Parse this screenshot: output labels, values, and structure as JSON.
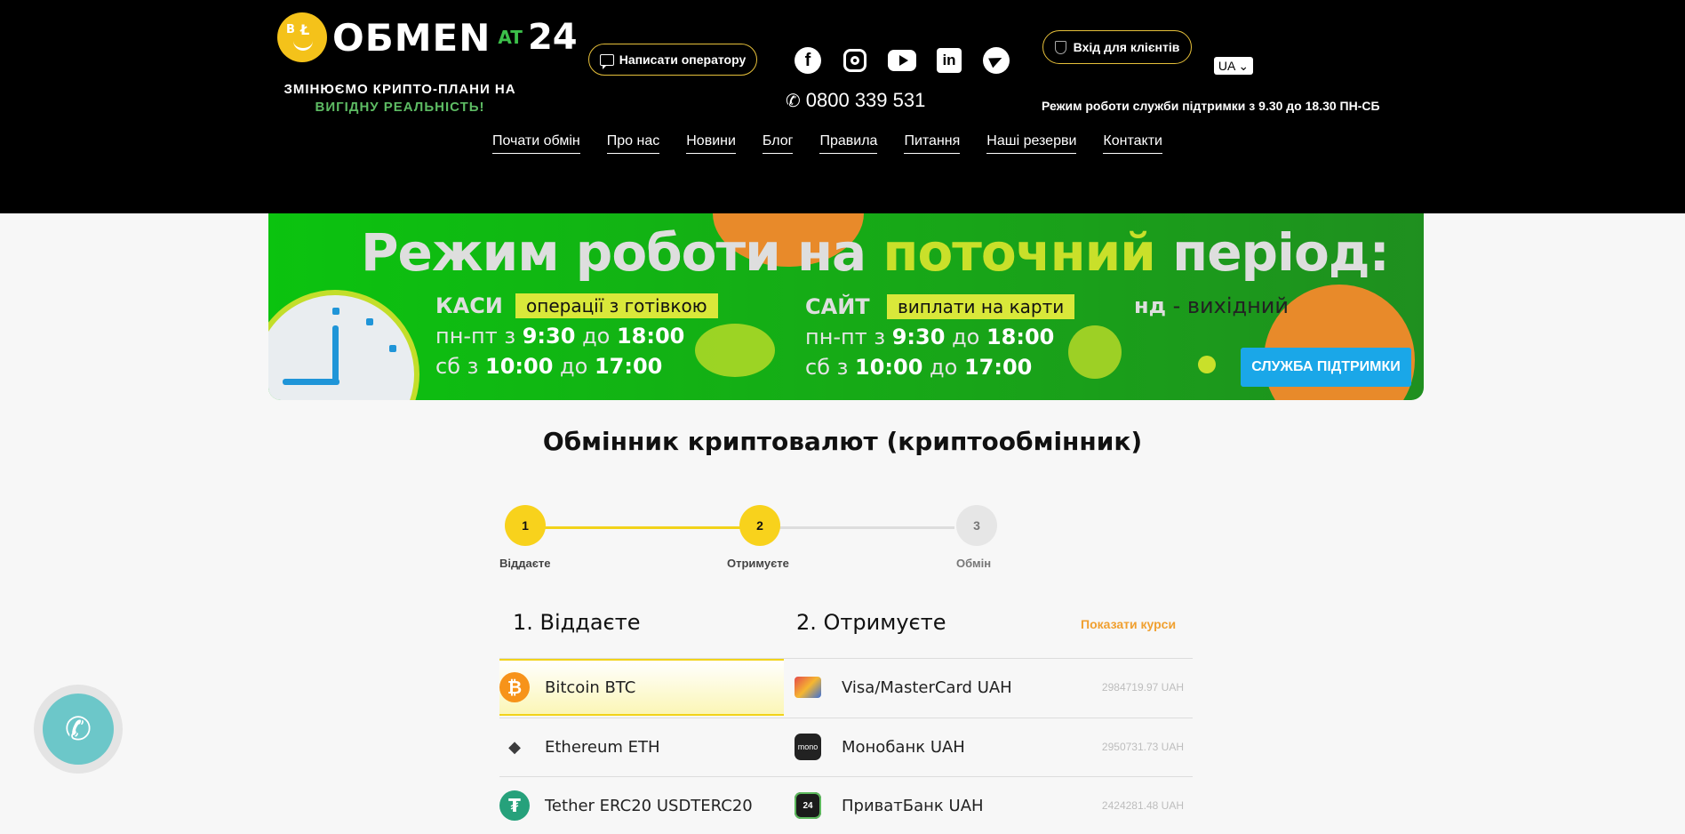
{
  "header": {
    "logo": {
      "word": "OБMEN",
      "at": "AT",
      "num": "24"
    },
    "slogan_line1": "ЗМІНЮЄМО КРИПТО-ПЛАНИ НА",
    "slogan_line2": "ВИГІДНУ РЕАЛЬНІСТЬ!",
    "operator_button": "Написати оператору",
    "phone": "0800 339 531",
    "login_button": "Вхід для клієнтів",
    "language": "UA",
    "support_hours": "Режим роботи служби підтримки з 9.30 до 18.30 ПН-СБ",
    "socials": [
      "facebook-icon",
      "instagram-icon",
      "youtube-icon",
      "linkedin-icon",
      "telegram-icon"
    ]
  },
  "nav": [
    "Почати обмін",
    "Про нас",
    "Новини",
    "Блог",
    "Правила",
    "Питання",
    "Наші резерви",
    "Контакти"
  ],
  "banner": {
    "title_start": "Режим роботи на ",
    "title_accent": "поточний",
    "title_end": " період:",
    "cash_label": "КАСИ",
    "cash_tag": "операції з готівкою",
    "cash_weekdays_pre": "пн-пт з ",
    "cash_weekdays_from": "9:30",
    "cash_weekdays_mid": " до ",
    "cash_weekdays_to": "18:00",
    "cash_sat_pre": "сб з ",
    "cash_sat_from": "10:00",
    "cash_sat_mid": " до ",
    "cash_sat_to": "17:00",
    "site_label": "САЙТ",
    "site_tag": "виплати на карти",
    "site_weekdays_pre": "пн-пт з ",
    "site_weekdays_from": "9:30",
    "site_weekdays_mid": " до ",
    "site_weekdays_to": "18:00",
    "site_sat_pre": "сб з ",
    "site_sat_from": "10:00",
    "site_sat_mid": " до ",
    "site_sat_to": "17:00",
    "dayoff_day": "нд",
    "dayoff_text": " - вихідний",
    "support_button": "СЛУЖБА ПІДТРИМКИ"
  },
  "page_title": "Обмінник криптовалют (криптообмінник)",
  "steps": [
    {
      "num": "1",
      "label": "Віддаєте"
    },
    {
      "num": "2",
      "label": "Отримуєте"
    },
    {
      "num": "3",
      "label": "Обмін"
    }
  ],
  "exchange": {
    "give_header": "1. Віддаєте",
    "get_header": "2. Отримуєте",
    "show_rates": "Показати курси",
    "give": [
      {
        "name": "Bitcoin BTC",
        "icon": "bitcoin-icon",
        "color": "#f7931a",
        "glyph": "₿",
        "selected": true
      },
      {
        "name": "Ethereum ETH",
        "icon": "ethereum-icon",
        "color": "#3c3c3d",
        "glyph": "◆",
        "selected": false
      },
      {
        "name": "Tether ERC20 USDTERC20",
        "icon": "tether-icon",
        "color": "#26a17b",
        "glyph": "₮",
        "selected": false
      }
    ],
    "get": [
      {
        "name": "Visa/MasterCard UAH",
        "icon": "card-icon",
        "reserve": "2984719.97 UAH"
      },
      {
        "name": "Монобанк UAH",
        "icon": "monobank-icon",
        "badge": "mono",
        "reserve": "2950731.73 UAH"
      },
      {
        "name": "ПриватБанк UAH",
        "icon": "privatbank-icon",
        "badge": "24",
        "reserve": "2424281.48 UAH"
      }
    ]
  },
  "colors": {
    "accent_yellow": "#f2d31a",
    "banner_green": "#0bc30f",
    "support_blue": "#1aa7e8",
    "call_teal": "#6cc7c9"
  }
}
